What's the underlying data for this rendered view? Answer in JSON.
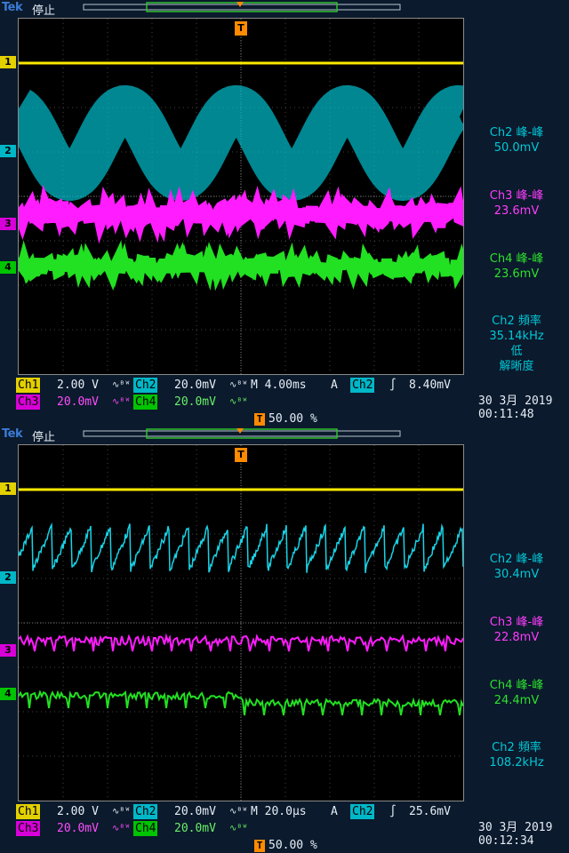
{
  "screens": [
    {
      "brand": "Tek",
      "status": "停止",
      "measurements": [
        {
          "line1": "Ch2 峰-峰",
          "line2": "50.0mV",
          "color": "#00c8d8"
        },
        {
          "line1": "Ch3 峰-峰",
          "line2": "23.6mV",
          "color": "#ff3cff"
        },
        {
          "line1": "Ch4 峰-峰",
          "line2": "23.6mV",
          "color": "#2ee02e"
        },
        {
          "line1": "Ch2 頻率",
          "line2": "35.14kHz",
          "line3": "低",
          "line4": "解晰度",
          "color": "#00c8d8"
        }
      ],
      "ch1": {
        "label": "Ch1",
        "scale": "2.00 V"
      },
      "ch2": {
        "label": "Ch2",
        "scale": "20.0mV"
      },
      "ch3": {
        "label": "Ch3",
        "scale": "20.0mV"
      },
      "ch4": {
        "label": "Ch4",
        "scale": "20.0mV"
      },
      "timebase": "M 4.00ms",
      "acq": "A",
      "trigger_ch": "Ch2",
      "trigger_level": "8.40mV",
      "trigger_pos": "50.00 %",
      "date": "30 3月  2019",
      "time": "00:11:48",
      "markers": [
        "1",
        "2",
        "3",
        "4"
      ]
    },
    {
      "brand": "Tek",
      "status": "停止",
      "measurements": [
        {
          "line1": "Ch2 峰-峰",
          "line2": "30.4mV",
          "color": "#00c8d8"
        },
        {
          "line1": "Ch3 峰-峰",
          "line2": "22.8mV",
          "color": "#ff3cff"
        },
        {
          "line1": "Ch4 峰-峰",
          "line2": "24.4mV",
          "color": "#2ee02e"
        },
        {
          "line1": "Ch2 頻率",
          "line2": "108.2kHz",
          "color": "#00c8d8"
        }
      ],
      "ch1": {
        "label": "Ch1",
        "scale": "2.00 V"
      },
      "ch2": {
        "label": "Ch2",
        "scale": "20.0mV"
      },
      "ch3": {
        "label": "Ch3",
        "scale": "20.0mV"
      },
      "ch4": {
        "label": "Ch4",
        "scale": "20.0mV"
      },
      "timebase": "M 20.0µs",
      "acq": "A",
      "trigger_ch": "Ch2",
      "trigger_level": "25.6mV",
      "trigger_pos": "50.00 %",
      "date": "30 3月  2019",
      "time": "00:12:34",
      "markers": [
        "1",
        "2",
        "3",
        "4"
      ]
    }
  ]
}
